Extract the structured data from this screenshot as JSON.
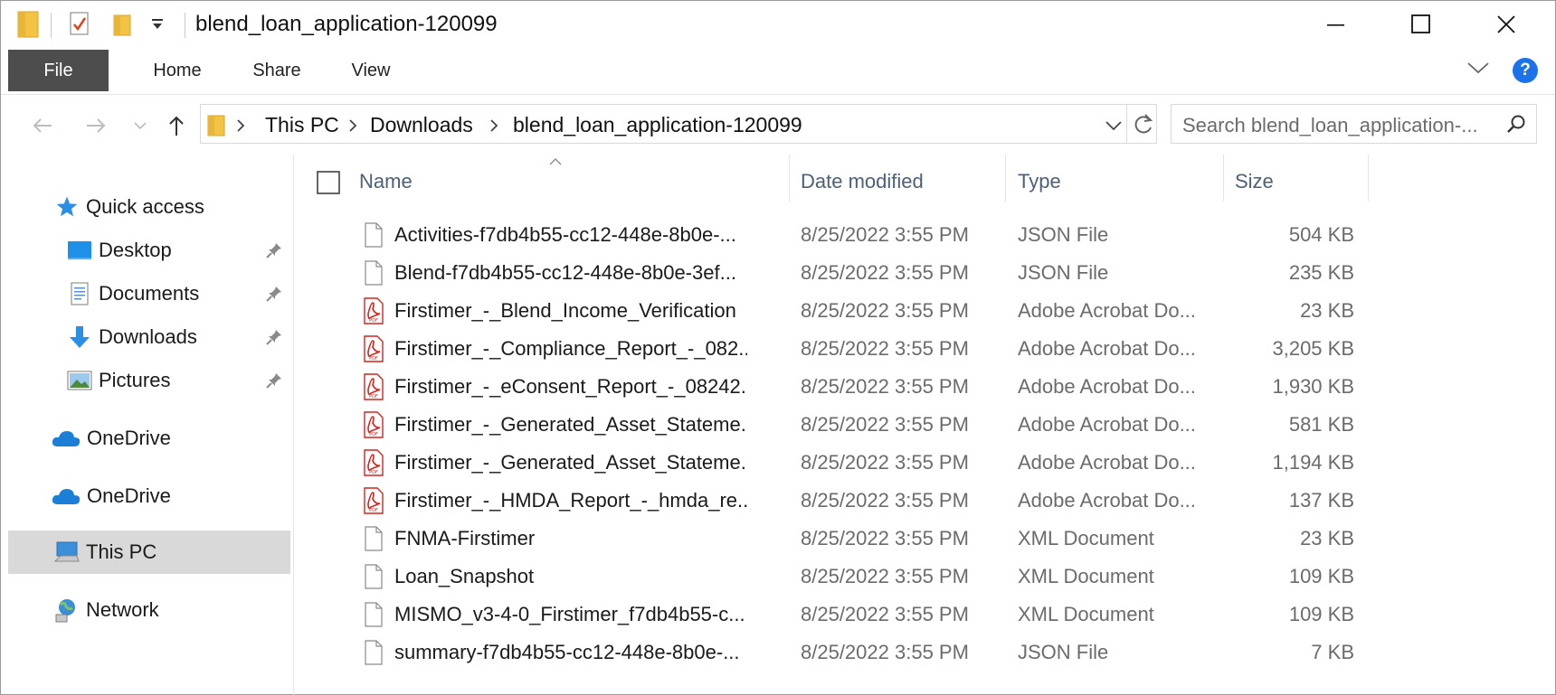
{
  "window": {
    "title": "blend_loan_application-120099"
  },
  "ribbon": {
    "tabs": [
      "File",
      "Home",
      "Share",
      "View"
    ],
    "help_label": "?"
  },
  "address": {
    "crumbs": [
      "This PC",
      "Downloads",
      "blend_loan_application-120099"
    ]
  },
  "search": {
    "placeholder": "Search blend_loan_application-..."
  },
  "sidebar": {
    "items": [
      {
        "label": "Quick access",
        "icon": "star-icon",
        "pinned": false
      },
      {
        "label": "Desktop",
        "icon": "desktop-icon",
        "pinned": true
      },
      {
        "label": "Documents",
        "icon": "documents-icon",
        "pinned": true
      },
      {
        "label": "Downloads",
        "icon": "download-arrow-icon",
        "pinned": true
      },
      {
        "label": "Pictures",
        "icon": "pictures-icon",
        "pinned": true
      },
      {
        "label": "OneDrive",
        "icon": "cloud-icon",
        "pinned": false
      },
      {
        "label": "OneDrive",
        "icon": "cloud-icon",
        "pinned": false
      },
      {
        "label": "This PC",
        "icon": "computer-icon",
        "pinned": false,
        "selected": true
      },
      {
        "label": "Network",
        "icon": "network-icon",
        "pinned": false
      }
    ]
  },
  "columns": {
    "name": "Name",
    "date": "Date modified",
    "type": "Type",
    "size": "Size"
  },
  "files": [
    {
      "name": "Activities-f7db4b55-cc12-448e-8b0e-...",
      "date": "8/25/2022 3:55 PM",
      "type": "JSON File",
      "size": "504 KB",
      "icon": "file-icon"
    },
    {
      "name": "Blend-f7db4b55-cc12-448e-8b0e-3ef...",
      "date": "8/25/2022 3:55 PM",
      "type": "JSON File",
      "size": "235 KB",
      "icon": "file-icon"
    },
    {
      "name": "Firstimer_-_Blend_Income_Verification",
      "date": "8/25/2022 3:55 PM",
      "type": "Adobe Acrobat Do...",
      "size": "23 KB",
      "icon": "pdf-icon"
    },
    {
      "name": "Firstimer_-_Compliance_Report_-_082...",
      "date": "8/25/2022 3:55 PM",
      "type": "Adobe Acrobat Do...",
      "size": "3,205 KB",
      "icon": "pdf-icon"
    },
    {
      "name": "Firstimer_-_eConsent_Report_-_08242...",
      "date": "8/25/2022 3:55 PM",
      "type": "Adobe Acrobat Do...",
      "size": "1,930 KB",
      "icon": "pdf-icon"
    },
    {
      "name": "Firstimer_-_Generated_Asset_Stateme...",
      "date": "8/25/2022 3:55 PM",
      "type": "Adobe Acrobat Do...",
      "size": "581 KB",
      "icon": "pdf-icon"
    },
    {
      "name": "Firstimer_-_Generated_Asset_Stateme...",
      "date": "8/25/2022 3:55 PM",
      "type": "Adobe Acrobat Do...",
      "size": "1,194 KB",
      "icon": "pdf-icon"
    },
    {
      "name": "Firstimer_-_HMDA_Report_-_hmda_re...",
      "date": "8/25/2022 3:55 PM",
      "type": "Adobe Acrobat Do...",
      "size": "137 KB",
      "icon": "pdf-icon"
    },
    {
      "name": "FNMA-Firstimer",
      "date": "8/25/2022 3:55 PM",
      "type": "XML Document",
      "size": "23 KB",
      "icon": "file-icon"
    },
    {
      "name": "Loan_Snapshot",
      "date": "8/25/2022 3:55 PM",
      "type": "XML Document",
      "size": "109 KB",
      "icon": "file-icon"
    },
    {
      "name": "MISMO_v3-4-0_Firstimer_f7db4b55-c...",
      "date": "8/25/2022 3:55 PM",
      "type": "XML Document",
      "size": "109 KB",
      "icon": "file-icon"
    },
    {
      "name": "summary-f7db4b55-cc12-448e-8b0e-...",
      "date": "8/25/2022 3:55 PM",
      "type": "JSON File",
      "size": "7 KB",
      "icon": "file-icon"
    }
  ],
  "colors": {
    "accent": "#1a73e8",
    "file_tab": "#4d4d4d",
    "selected": "#d9d9d9",
    "header_text": "#4c607a",
    "pdf_red": "#d4231c",
    "folder_yellow": "#f3c443"
  }
}
